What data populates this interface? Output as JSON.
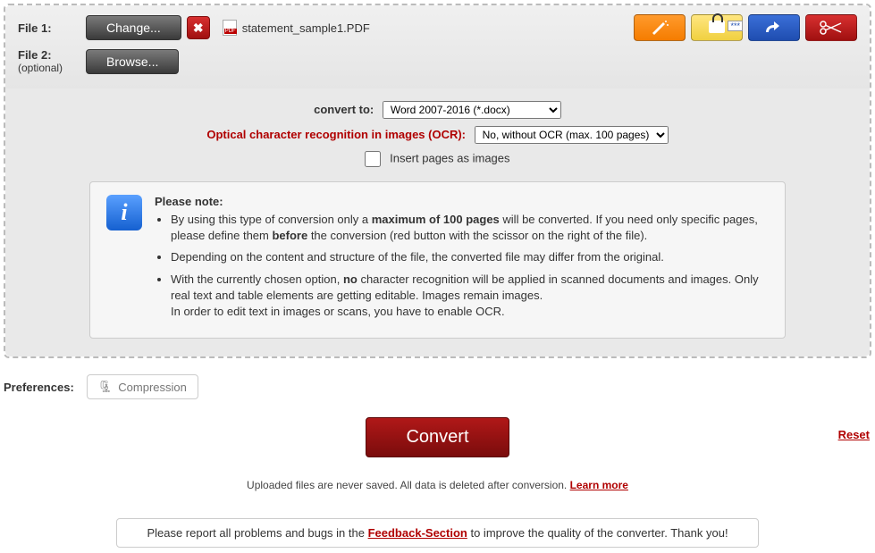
{
  "file1": {
    "label": "File 1:",
    "change_btn": "Change...",
    "filename": "statement_sample1.PDF"
  },
  "file2": {
    "label": "File 2:",
    "sublabel": "(optional)",
    "browse_btn": "Browse..."
  },
  "options": {
    "convert_to_label": "convert to:",
    "convert_to_value": "Word 2007-2016 (*.docx)",
    "ocr_label": "Optical character recognition in images (OCR):",
    "ocr_value": "No, without OCR (max. 100 pages)",
    "insert_images_label": "Insert pages as images"
  },
  "note": {
    "title": "Please note:",
    "b1a": "By using this type of conversion only a ",
    "b1b": "maximum of 100 pages",
    "b1c": " will be converted. If you need only specific pages, please define them ",
    "b1d": "before",
    "b1e": " the conversion (red button with the scissor on the right of the file).",
    "b2": "Depending on the content and structure of the file, the converted file may differ from the original.",
    "b3a": "With the currently chosen option, ",
    "b3b": "no",
    "b3c": " character recognition will be applied in scanned documents and images. Only real text and table elements are getting editable. Images remain images.",
    "b3d": "In order to edit text in images or scans, you have to enable OCR."
  },
  "prefs": {
    "label": "Preferences:",
    "compression": "Compression"
  },
  "convert": {
    "button": "Convert",
    "reset": "Reset"
  },
  "disclaimer": {
    "text": "Uploaded files are never saved. All data is deleted after conversion. ",
    "link": "Learn more"
  },
  "feedback": {
    "t1": "Please report all problems and bugs in the ",
    "link": "Feedback-Section",
    "t2": " to improve the quality of the converter. Thank you!"
  }
}
